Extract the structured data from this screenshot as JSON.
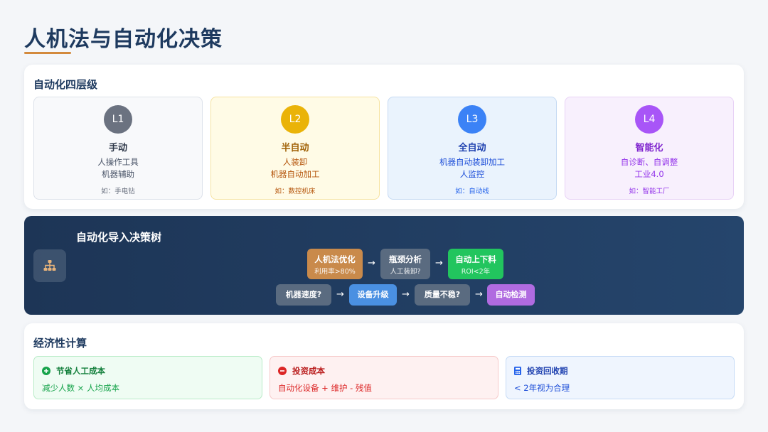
{
  "page": {
    "title": "人机法与自动化决策"
  },
  "levels_section": {
    "title": "自动化四层级",
    "levels": [
      {
        "badge": "L1",
        "name": "手动",
        "desc1": "人操作工具",
        "desc2": "机器辅助",
        "example": "如：手电钻",
        "color": "#6b7280"
      },
      {
        "badge": "L2",
        "name": "半自动",
        "desc1": "人装卸",
        "desc2": "机器自动加工",
        "example": "如：数控机床",
        "color": "#eab308"
      },
      {
        "badge": "L3",
        "name": "全自动",
        "desc1": "机器自动装卸加工",
        "desc2": "人监控",
        "example": "如：自动线",
        "color": "#3b82f6"
      },
      {
        "badge": "L4",
        "name": "智能化",
        "desc1": "自诊断、自调整",
        "desc2": "工业4.0",
        "example": "如：智能工厂",
        "color": "#a855f7"
      }
    ]
  },
  "decision_tree": {
    "title": "自动化导入决策树",
    "icon": "sitemap-icon",
    "row1": [
      {
        "label": "人机法优化",
        "sub": "利用率>80%",
        "color": "#c98a4b"
      },
      {
        "label": "瓶颈分析",
        "sub": "人工装卸?",
        "color": "#5a6b80"
      },
      {
        "label": "自动上下料",
        "sub": "ROI<2年",
        "color": "#22c55e"
      }
    ],
    "row2": [
      {
        "label": "机器速度?",
        "color": "#5a6b80"
      },
      {
        "label": "设备升级",
        "color": "#4a90e2"
      },
      {
        "label": "质量不稳?",
        "color": "#5a6b80"
      },
      {
        "label": "自动检测",
        "color": "#b06be0"
      }
    ],
    "arrow": "→"
  },
  "economics": {
    "title": "经济性计算",
    "items": [
      {
        "title": "节省人工成本",
        "text": "减少人数 × 人均成本",
        "icon": "plus-circle-icon"
      },
      {
        "title": "投资成本",
        "text": "自动化设备 + 维护 - 残值",
        "icon": "minus-circle-icon"
      },
      {
        "title": "投资回收期",
        "text": "< 2年视为合理",
        "icon": "calculator-icon"
      }
    ]
  }
}
